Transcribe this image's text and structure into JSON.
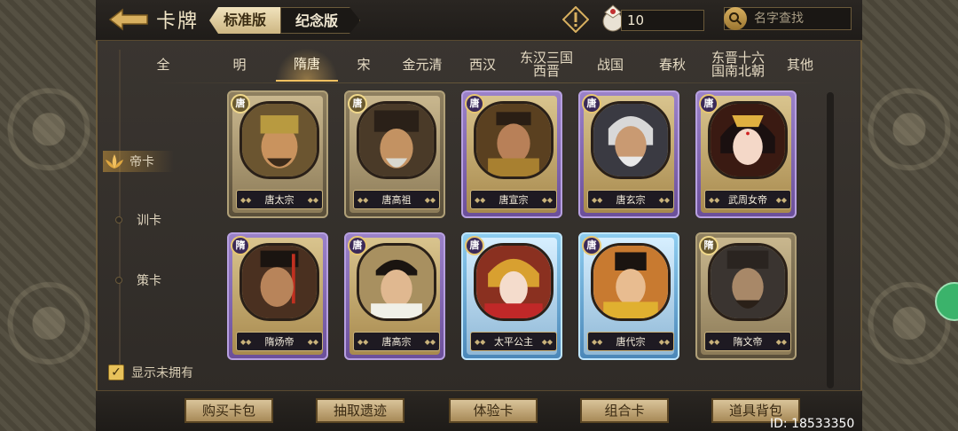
{
  "header": {
    "title": "卡牌",
    "version_tabs": [
      {
        "label": "标准版",
        "active": true
      },
      {
        "label": "纪念版",
        "active": false
      }
    ],
    "currency_value": "10",
    "search_placeholder": "名字查找"
  },
  "dynasties": [
    {
      "label": "全",
      "active": false
    },
    {
      "label": "明",
      "active": false
    },
    {
      "label": "隋唐",
      "active": true
    },
    {
      "label": "宋",
      "active": false
    },
    {
      "label": "金元清",
      "active": false
    },
    {
      "label": "西汉",
      "active": false
    },
    {
      "label": "东汉三国\n西晋",
      "active": false
    },
    {
      "label": "战国",
      "active": false
    },
    {
      "label": "春秋",
      "active": false
    },
    {
      "label": "东晋十六\n国南北朝",
      "active": false
    },
    {
      "label": "其他",
      "active": false
    }
  ],
  "nav": [
    {
      "label": "帝卡",
      "active": true
    },
    {
      "label": "训卡",
      "active": false
    },
    {
      "label": "策卡",
      "active": false
    }
  ],
  "cards": [
    {
      "name": "唐太宗",
      "badge": "唐",
      "frame": "gold"
    },
    {
      "name": "唐高祖",
      "badge": "唐",
      "frame": "gold"
    },
    {
      "name": "唐宣宗",
      "badge": "唐",
      "frame": "purple"
    },
    {
      "name": "唐玄宗",
      "badge": "唐",
      "frame": "purple"
    },
    {
      "name": "武周女帝",
      "badge": "唐",
      "frame": "purple"
    },
    {
      "name": "隋炀帝",
      "badge": "隋",
      "frame": "purple"
    },
    {
      "name": "唐高宗",
      "badge": "唐",
      "frame": "purple"
    },
    {
      "name": "太平公主",
      "badge": "唐",
      "frame": "blue"
    },
    {
      "name": "唐代宗",
      "badge": "唐",
      "frame": "blue"
    },
    {
      "name": "隋文帝",
      "badge": "隋",
      "frame": "gray"
    }
  ],
  "show_unowned": {
    "label": "显示未拥有",
    "checked": true
  },
  "bottom_buttons": [
    "购买卡包",
    "抽取遗迹",
    "体验卡",
    "组合卡",
    "道具背包"
  ],
  "id_text": "ID: 18533350",
  "colors": {
    "accent_gold": "#e8c25a",
    "purple_frame": "#9b82c9",
    "blue_frame": "#8ecdf0"
  }
}
